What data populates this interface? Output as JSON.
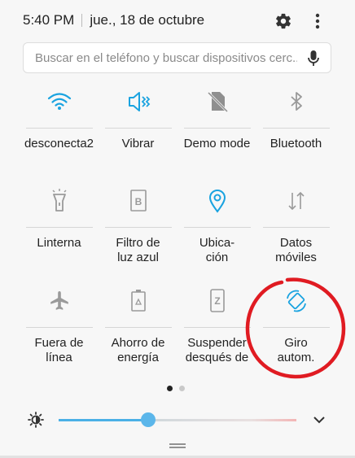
{
  "status": {
    "time": "5:40 PM",
    "date": "jue., 18 de octubre"
  },
  "search": {
    "placeholder": "Buscar en el teléfono y buscar dispositivos cerc..."
  },
  "tiles": [
    {
      "label": "desconecta2",
      "icon": "wifi-icon",
      "active": true
    },
    {
      "label": "Vibrar",
      "icon": "vibrate-icon",
      "active": true
    },
    {
      "label": "Demo mode",
      "icon": "demo-mode-icon",
      "active": false
    },
    {
      "label": "Bluetooth",
      "icon": "bluetooth-icon",
      "active": false
    },
    {
      "label": "Linterna",
      "icon": "flashlight-icon",
      "active": false
    },
    {
      "label": "Filtro de\nluz azul",
      "icon": "blue-light-filter-icon",
      "active": false
    },
    {
      "label": "Ubica-\nción",
      "icon": "location-icon",
      "active": true
    },
    {
      "label": "Datos\nmóviles",
      "icon": "mobile-data-icon",
      "active": false
    },
    {
      "label": "Fuera de\nlínea",
      "icon": "airplane-icon",
      "active": false
    },
    {
      "label": "Ahorro de\nenergía",
      "icon": "power-saving-icon",
      "active": false
    },
    {
      "label": "Suspender\ndesqués de",
      "icon": "screen-timeout-icon",
      "active": false
    },
    {
      "label": "Giro\nautom.",
      "icon": "auto-rotate-icon",
      "active": true
    }
  ],
  "pager": {
    "current_page": 1,
    "total_pages": 2
  },
  "brightness": {
    "level": 0.37
  },
  "colors": {
    "accent": "#1aa3e0",
    "inactive": "#9a9a9a",
    "annotation": "#e01b22"
  }
}
